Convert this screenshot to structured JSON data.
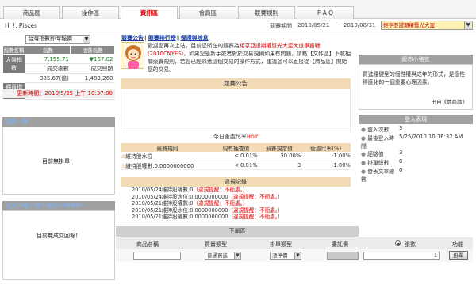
{
  "tabs": [
    {
      "label": "商品區"
    },
    {
      "label": "操作區"
    },
    {
      "label": "資訊區"
    },
    {
      "label": "會員區"
    },
    {
      "label": "競賽規則"
    },
    {
      "label": "F A Q"
    }
  ],
  "active_tab": "資訊區",
  "greeting": "Hi !, Pisces",
  "contest": {
    "period_label": "競賽期間",
    "from": "2010/05/21",
    "sep": "~",
    "to": "2010/08/31",
    "selected": "鉅亨亞證期權暨光大盃",
    "select_arrow": "▼"
  },
  "quote_dropdown": {
    "value": "台灣指數即時報價",
    "arrow": "▼"
  },
  "index_table": {
    "headers": [
      "指數名稱",
      "指數",
      "漲跌指數"
    ],
    "rows": [
      {
        "name": "大盤指數",
        "index": "7,155.71",
        "change": "▼167.02",
        "vol_label": "成交張數",
        "vol_label2": "成交總額",
        "vol": "385.67(億)",
        "vol2": "1,483,260"
      },
      {
        "name": "期貨指數",
        "index": "7,108.00",
        "change": "▼166.00"
      }
    ],
    "update": "更新時間：2010/5/25 上午 10:37:00"
  },
  "left_panels": {
    "stock_watch": {
      "title": "盤勢一覽",
      "message": "目前無掛單！"
    },
    "trade_report": {
      "title": "成交回報(只顯示最近10筆資料)",
      "message": "目前無成交回報！"
    }
  },
  "links": [
    "競賽公告",
    "競賽排行榜",
    "保證與除息"
  ],
  "links_sep": "|",
  "welcome": {
    "pre": "歡迎您再次上站，目前您所在的競賽為",
    "contest_name": "鉅亨亞證期權暨光大盃大道爭霸戰(2010CNYES)",
    "post": "，如果您是新手或者對於交易規則如果有問題，請點【文件區】下載相關競賽規則，若您已經熟悉這個交易的操作方式，建議您可以直接從【商品區】開始您的交易。"
  },
  "announcement": {
    "title": "競賽公告"
  },
  "today": {
    "title": "今日衝處比率",
    "hot": "HOT",
    "headers": [
      "競賽規則",
      "現有抽查值",
      "競賽規定值",
      "衝處比率(%)"
    ],
    "rows": [
      {
        "rule": "維持股水位",
        "current": "< 0.01%",
        "limit": "30.00%",
        "ratio": "-1.00%"
      },
      {
        "rule": "維持股權數:0.0000000000",
        "current": "< 0.01%",
        "limit": "3",
        "ratio": "-1.00%"
      }
    ]
  },
  "records": {
    "title": "違規記錄",
    "rows": [
      {
        "date": "2010/05/24",
        "text": "維持股權數:0",
        "alert": "（違規提醒：不衝處。）"
      },
      {
        "date": "2010/05/24",
        "text": "維持股水位:0.0000000000",
        "alert": "（違規提醒：不衝處。）"
      },
      {
        "date": "2010/05/21",
        "text": "維持股權數:0",
        "alert": "（違規提醒：不衝處。）"
      },
      {
        "date": "2010/05/21",
        "text": "維持股水位:0.0000000000",
        "alert": "（違規提醒：不衝處。）"
      },
      {
        "date": "2010/05/21",
        "text": "維持股權數:0.0000000000",
        "alert": "（違規提醒：不衝處。）"
      }
    ]
  },
  "tips": {
    "title": "股市小格言",
    "text": "買進穩健型的個性權與成年的形式，是個性得應化的一個重要心理因素。",
    "link": "出自《情商論》"
  },
  "login": {
    "title": "登入表現",
    "rows": [
      {
        "label": "登入次數",
        "value": "3"
      },
      {
        "label": "最後登入時間",
        "value": "5/25/2010 10:16:32 AM"
      },
      {
        "label": "經驗值",
        "value": "3"
      },
      {
        "label": "掛單總數",
        "value": "0"
      },
      {
        "label": "發表文章總數",
        "value": "0"
      }
    ],
    "bullet": "●"
  },
  "order": {
    "title": "下單區",
    "columns": [
      "商品名稱",
      "買賣類型",
      "掛單類型",
      "委託價",
      "張數",
      "功能"
    ],
    "trade_type": "普通買進",
    "order_type": "漲停價",
    "qty": "1",
    "submit": "掛單",
    "arrow": "▼"
  }
}
